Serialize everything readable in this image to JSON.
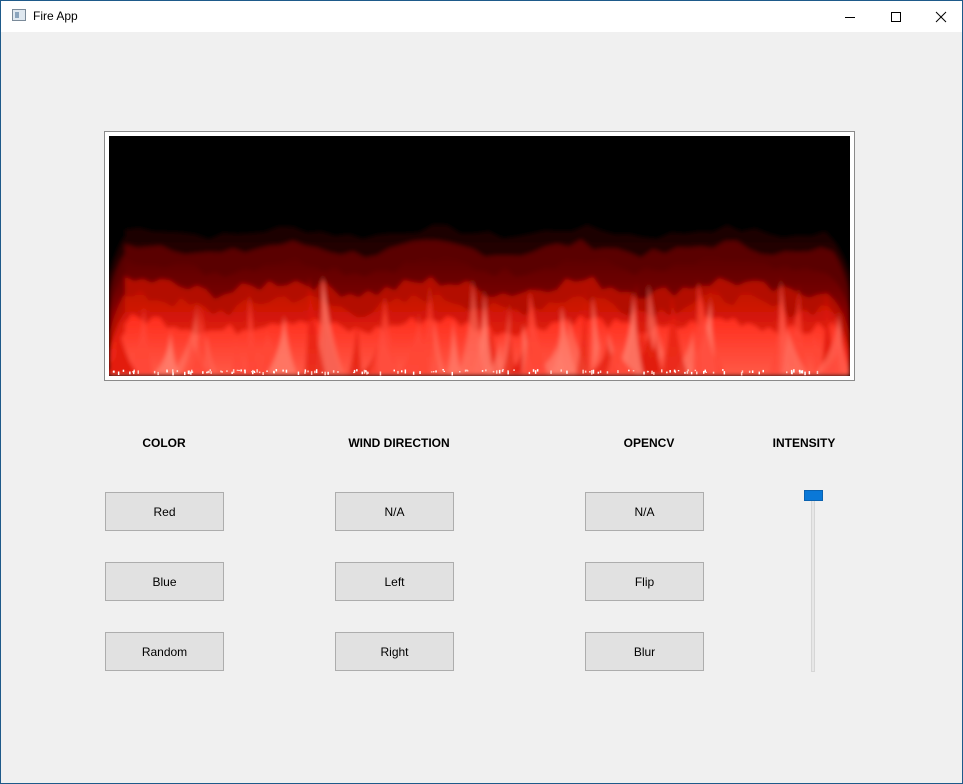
{
  "window": {
    "title": "Fire App",
    "icon": "app-window-icon"
  },
  "titlebar_controls": {
    "minimize_icon": "minimize-icon",
    "maximize_icon": "maximize-icon",
    "close_icon": "close-icon"
  },
  "fire_view": {
    "background": "#000000",
    "flame_colors": [
      "#ff2a1a",
      "#ff4a3a",
      "#ff8070"
    ]
  },
  "color_group": {
    "header": "COLOR",
    "buttons": [
      "Red",
      "Blue",
      "Random"
    ]
  },
  "wind_group": {
    "header": "WIND DIRECTION",
    "buttons": [
      "N/A",
      "Left",
      "Right"
    ]
  },
  "opencv_group": {
    "header": "OPENCV",
    "buttons": [
      "N/A",
      "Flip",
      "Blur"
    ]
  },
  "intensity_group": {
    "header": "INTENSITY",
    "value_fraction": 1.0,
    "accent": "#0a78d7"
  }
}
